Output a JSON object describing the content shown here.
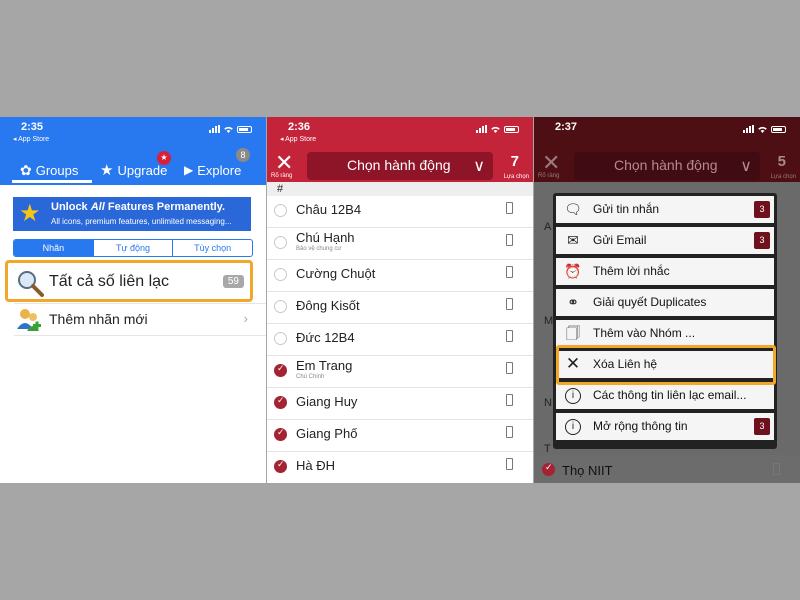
{
  "status": {
    "panel1_time": "2:35",
    "panel2_time": "2:36",
    "panel3_time": "2:37",
    "back_label": "◂ App Store"
  },
  "panel1": {
    "tabs": {
      "groups": "Groups",
      "upgrade": "Upgrade",
      "explore": "Explore",
      "explore_badge": "8"
    },
    "banner": {
      "title_pre": "Unlock ",
      "title_em": "All",
      "title_post": " Features Permanently.",
      "subtitle": "All icons, premium features, unlimited messaging..."
    },
    "segments": [
      "Nhãn",
      "Tự động",
      "Tùy chọn"
    ],
    "all_contacts_label": "Tất cả số liên lạc",
    "all_contacts_count": "59",
    "add_label": "Thêm nhãn mới"
  },
  "panel2": {
    "close_label": "Rõ ràng",
    "action_label": "Chọn hành động",
    "selected_count": "7",
    "selected_label": "Lựa chọn",
    "section_header": "#",
    "contacts": [
      {
        "name": "Châu 12B4",
        "sub": "",
        "checked": false
      },
      {
        "name": "Chú Hạnh",
        "sub": "Bảo vệ chung cư",
        "checked": false
      },
      {
        "name": "Cường Chuột",
        "sub": "",
        "checked": false
      },
      {
        "name": "Đông Kisốt",
        "sub": "",
        "checked": false
      },
      {
        "name": "Đức 12B4",
        "sub": "",
        "checked": false
      },
      {
        "name": "Em Trang",
        "sub": "Chú Chinh",
        "checked": true
      },
      {
        "name": "Giang Huy",
        "sub": "",
        "checked": true
      },
      {
        "name": "Giang Phố",
        "sub": "",
        "checked": true
      },
      {
        "name": "Hà ĐH",
        "sub": "",
        "checked": true
      }
    ]
  },
  "panel3": {
    "close_label": "Rõ ràng",
    "action_label": "Chọn hành động",
    "selected_count": "5",
    "selected_label": "Lựa chọn",
    "menu": [
      {
        "label": "Gửi tin nhắn",
        "icon": "message-icon",
        "badge": "3"
      },
      {
        "label": "Gửi Email",
        "icon": "email-icon",
        "badge": "3"
      },
      {
        "label": "Thêm lời nhắc",
        "icon": "alarm-icon",
        "badge": ""
      },
      {
        "label": "Giải quyết Duplicates",
        "icon": "duplicates-icon",
        "badge": ""
      },
      {
        "label": "Thêm vào Nhóm ...",
        "icon": "group-doc-icon",
        "badge": ""
      },
      {
        "label": "Xóa Liên hệ",
        "icon": "delete-x-icon",
        "badge": ""
      },
      {
        "label": "Các thông tin liên lạc email...",
        "icon": "info-icon",
        "badge": ""
      },
      {
        "label": "Mở rộng thông tin",
        "icon": "info-plus-icon",
        "badge": "3"
      }
    ],
    "bottom_contact": "Thọ NIIT",
    "side_letters": [
      "A",
      "M",
      "N",
      "T"
    ]
  },
  "colors": {
    "blue": "#2878f0",
    "red": "#c4243a",
    "dark_red": "#4d0e14",
    "highlight": "#f2a72a"
  }
}
